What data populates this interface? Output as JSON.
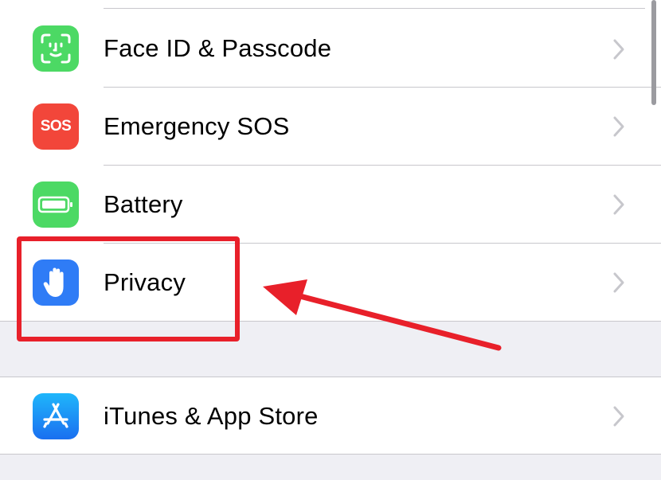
{
  "settings": {
    "rows": [
      {
        "label": "Face ID & Passcode",
        "icon": "face-id-icon",
        "color": "#4cd964"
      },
      {
        "label": "Emergency SOS",
        "icon": "sos-icon",
        "icon_text": "SOS",
        "color": "#f2463a"
      },
      {
        "label": "Battery",
        "icon": "battery-icon",
        "color": "#4cd964"
      },
      {
        "label": "Privacy",
        "icon": "privacy-hand-icon",
        "color": "#2f7cf6"
      }
    ],
    "store_row": {
      "label": "iTunes & App Store",
      "icon": "app-store-icon",
      "color": "#1a8cf7"
    }
  },
  "annotation": {
    "highlight_color": "#e8202a",
    "highlighted_item": "Privacy"
  }
}
